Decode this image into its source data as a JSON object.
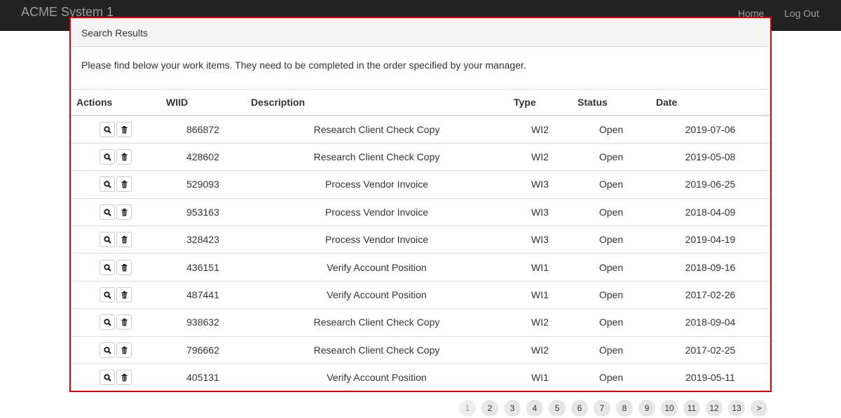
{
  "navbar": {
    "brand": "ACME System 1",
    "home": "Home",
    "logout": "Log Out"
  },
  "panel": {
    "title": "Search Results",
    "intro": "Please find below your work items. They need to be completed in the order specified by your manager."
  },
  "table": {
    "headers": {
      "actions": "Actions",
      "wiid": "WIID",
      "description": "Description",
      "type": "Type",
      "status": "Status",
      "date": "Date"
    },
    "rows": [
      {
        "wiid": "866872",
        "description": "Research Client Check Copy",
        "type": "WI2",
        "status": "Open",
        "date": "2019-07-06"
      },
      {
        "wiid": "428602",
        "description": "Research Client Check Copy",
        "type": "WI2",
        "status": "Open",
        "date": "2019-05-08"
      },
      {
        "wiid": "529093",
        "description": "Process Vendor Invoice",
        "type": "WI3",
        "status": "Open",
        "date": "2019-06-25"
      },
      {
        "wiid": "953163",
        "description": "Process Vendor Invoice",
        "type": "WI3",
        "status": "Open",
        "date": "2018-04-09"
      },
      {
        "wiid": "328423",
        "description": "Process Vendor Invoice",
        "type": "WI3",
        "status": "Open",
        "date": "2019-04-19"
      },
      {
        "wiid": "436151",
        "description": "Verify Account Position",
        "type": "WI1",
        "status": "Open",
        "date": "2018-09-16"
      },
      {
        "wiid": "487441",
        "description": "Verify Account Position",
        "type": "WI1",
        "status": "Open",
        "date": "2017-02-26"
      },
      {
        "wiid": "938632",
        "description": "Research Client Check Copy",
        "type": "WI2",
        "status": "Open",
        "date": "2018-09-04"
      },
      {
        "wiid": "796662",
        "description": "Research Client Check Copy",
        "type": "WI2",
        "status": "Open",
        "date": "2017-02-25"
      },
      {
        "wiid": "405131",
        "description": "Verify Account Position",
        "type": "WI1",
        "status": "Open",
        "date": "2019-05-11"
      }
    ],
    "row_actions": [
      "search-icon",
      "trash-icon"
    ]
  },
  "pagination": {
    "pages": [
      "1",
      "2",
      "3",
      "4",
      "5",
      "6",
      "7",
      "8",
      "9",
      "10",
      "11",
      "12",
      "13",
      ">"
    ],
    "active": "1"
  },
  "colors": {
    "navbar": "#222222",
    "highlight_border": "#dd0000"
  }
}
